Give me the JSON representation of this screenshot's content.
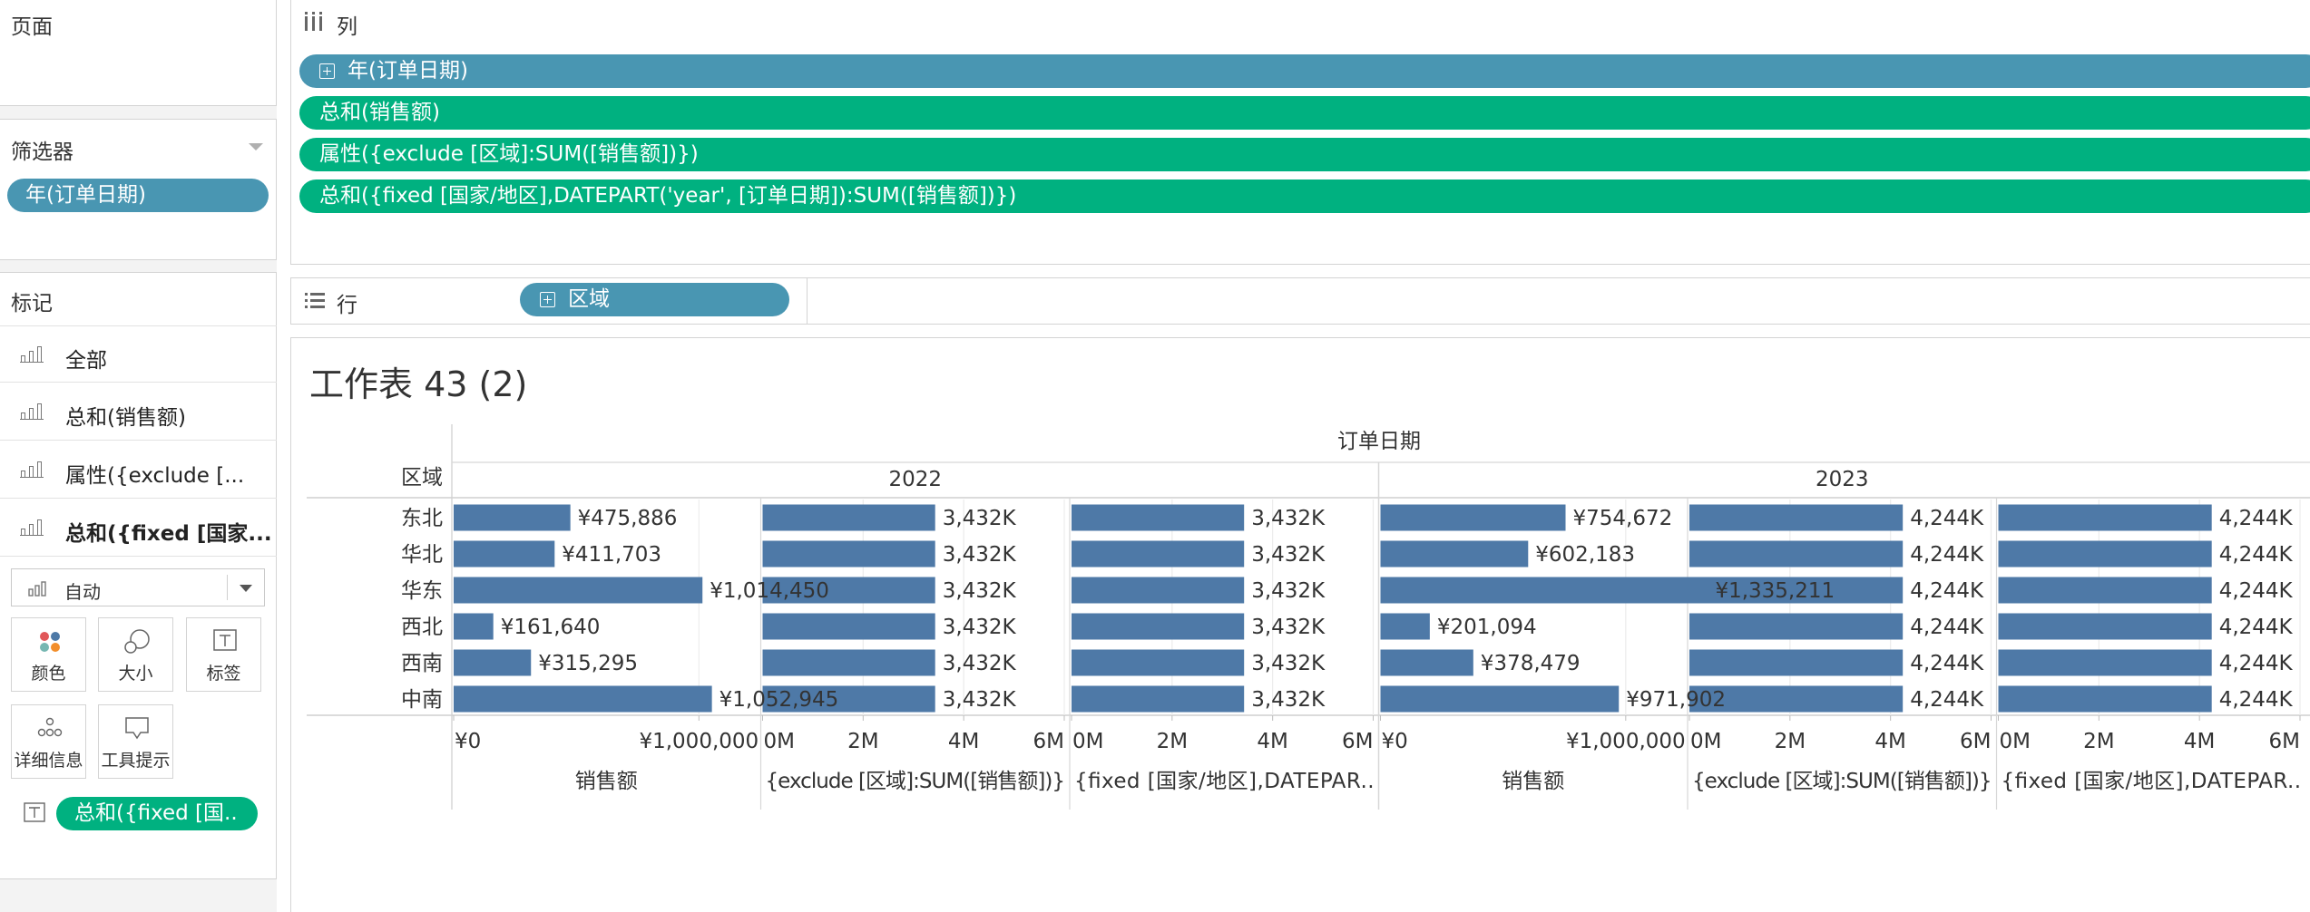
{
  "cards": {
    "pages": {
      "title": "页面"
    },
    "filters": {
      "title": "筛选器",
      "pill": "年(订单日期)"
    },
    "marks": {
      "title": "标记",
      "rows": [
        {
          "label": "全部",
          "bold": false
        },
        {
          "label": "总和(销售额)",
          "bold": false
        },
        {
          "label": "属性({exclude [...",
          "bold": false
        },
        {
          "label": "总和({fixed [国家...",
          "bold": true
        }
      ],
      "mark_type": "自动",
      "buttons": {
        "color": "颜色",
        "size": "大小",
        "label": "标签",
        "detail": "详细信息",
        "tooltip": "工具提示"
      },
      "label_pill": "总和({fixed [国.."
    }
  },
  "shelves": {
    "columns": {
      "label": "列",
      "pills": [
        {
          "text": "年(订单日期)",
          "color": "blue",
          "expand": true
        },
        {
          "text": "总和(销售额)",
          "color": "green",
          "expand": false
        },
        {
          "text": "属性({exclude [区域]:SUM([销售额])})",
          "color": "green",
          "expand": false
        },
        {
          "text": "总和({fixed [国家/地区],DATEPART('year', [订单日期]):SUM([销售额])})",
          "color": "green",
          "expand": false
        }
      ]
    },
    "rows": {
      "label": "行",
      "pill": "区域"
    }
  },
  "sheet": {
    "title": "工作表 43 (2)"
  },
  "colors": {
    "bar": "#4e79a7",
    "pill_blue": "#4996b2",
    "pill_green": "#00b180",
    "mark_color_dots": [
      "#e15759",
      "#4e79a7",
      "#76b7b2",
      "#f28e2b"
    ]
  },
  "chart_data": {
    "type": "bar",
    "orientation": "horizontal",
    "top_header": "订单日期",
    "row_header": "区域",
    "categories": [
      "东北",
      "华北",
      "华东",
      "西北",
      "西南",
      "中南"
    ],
    "years": [
      {
        "year": "2022",
        "panes": [
          {
            "axis_title": "销售额",
            "ticks": [
              "¥0",
              "¥1,000,000"
            ],
            "tick_values": [
              0,
              1000000
            ],
            "xlim": [
              0,
              1230000
            ],
            "values": [
              475886,
              411703,
              1014450,
              161640,
              315295,
              1052945
            ],
            "labels": [
              "¥475,886",
              "¥411,703",
              "¥1,014,450",
              "¥161,640",
              "¥315,295",
              "¥1,052,945"
            ]
          },
          {
            "axis_title": "{exclude [区域]:SUM([销售额])}",
            "ticks": [
              "0M",
              "2M",
              "4M",
              "6M"
            ],
            "tick_values": [
              0,
              2000000,
              4000000,
              6000000
            ],
            "xlim": [
              0,
              6000000
            ],
            "values": [
              3432000,
              3432000,
              3432000,
              3432000,
              3432000,
              3432000
            ],
            "labels": [
              "3,432K",
              "3,432K",
              "3,432K",
              "3,432K",
              "3,432K",
              "3,432K"
            ]
          },
          {
            "axis_title": "{fixed [国家/地区],DATEPAR..",
            "ticks": [
              "0M",
              "2M",
              "4M",
              "6M"
            ],
            "tick_values": [
              0,
              2000000,
              4000000,
              6000000
            ],
            "xlim": [
              0,
              6000000
            ],
            "values": [
              3432000,
              3432000,
              3432000,
              3432000,
              3432000,
              3432000
            ],
            "labels": [
              "3,432K",
              "3,432K",
              "3,432K",
              "3,432K",
              "3,432K",
              "3,432K"
            ]
          }
        ]
      },
      {
        "year": "2023",
        "panes": [
          {
            "axis_title": "销售额",
            "ticks": [
              "¥0",
              "¥1,000,000"
            ],
            "tick_values": [
              0,
              1000000
            ],
            "xlim": [
              0,
              1230000
            ],
            "values": [
              754672,
              602183,
              1335211,
              201094,
              378479,
              971902
            ],
            "labels": [
              "¥754,672",
              "¥602,183",
              "¥1,335,211",
              "¥201,094",
              "¥378,479",
              "¥971,902"
            ]
          },
          {
            "axis_title": "{exclude [区域]:SUM([销售额])}",
            "ticks": [
              "0M",
              "2M",
              "4M",
              "6M"
            ],
            "tick_values": [
              0,
              2000000,
              4000000,
              6000000
            ],
            "xlim": [
              0,
              6000000
            ],
            "values": [
              4244000,
              4244000,
              4244000,
              4244000,
              4244000,
              4244000
            ],
            "labels": [
              "4,244K",
              "4,244K",
              "4,244K",
              "4,244K",
              "4,244K",
              "4,244K"
            ]
          },
          {
            "axis_title": "{fixed [国家/地区],DATEPAR..",
            "ticks": [
              "0M",
              "2M",
              "4M",
              "6M"
            ],
            "tick_values": [
              0,
              2000000,
              4000000,
              6000000
            ],
            "xlim": [
              0,
              6000000
            ],
            "values": [
              4244000,
              4244000,
              4244000,
              4244000,
              4244000,
              4244000
            ],
            "labels": [
              "4,244K",
              "4,244K",
              "4,244K",
              "4,244K",
              "4,244K",
              "4,244K"
            ]
          }
        ]
      }
    ]
  }
}
